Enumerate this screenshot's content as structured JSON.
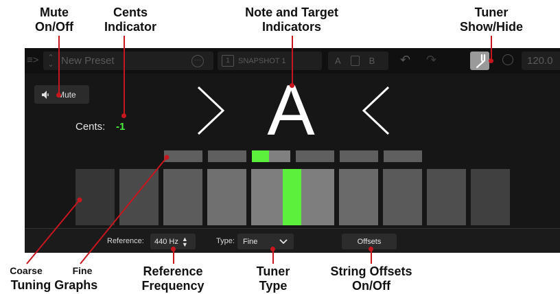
{
  "callouts": {
    "mute": [
      "Mute",
      "On/Off"
    ],
    "cents": [
      "Cents",
      "Indicator"
    ],
    "note_target": [
      "Note and Target",
      "Indicators"
    ],
    "tuner_show": [
      "Tuner",
      "Show/Hide"
    ],
    "coarse": "Coarse",
    "fine": "Fine",
    "tuning_graphs": "Tuning Graphs",
    "reference": [
      "Reference",
      "Frequency"
    ],
    "tuner_type": [
      "Tuner",
      "Type"
    ],
    "string_offsets": [
      "String Offsets",
      "On/Off"
    ]
  },
  "topbar": {
    "preset_name": "New Preset",
    "snapshot_number": "1",
    "snapshot_label": "SNAPSHOT 1",
    "a_label": "A",
    "b_label": "B",
    "tempo": "120.0"
  },
  "tuner": {
    "mute_label": "Mute",
    "cents_label": "Cents:",
    "cents_value": "-1",
    "note": "A",
    "fine_active_fraction": 0.45,
    "coarse_active_index": 4,
    "segments_fine": 6,
    "segments_coarse": 10,
    "active_color": "#5cf03c"
  },
  "bottombar": {
    "reference_label": "Reference:",
    "reference_value": "440 Hz",
    "type_label": "Type:",
    "type_value": "Fine",
    "offsets_label": "Offsets"
  }
}
